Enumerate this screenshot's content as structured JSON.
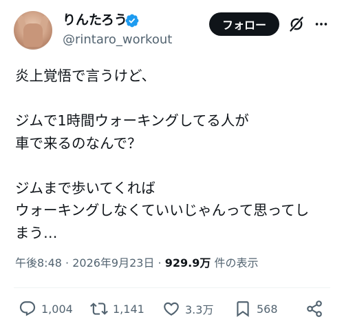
{
  "user": {
    "display_name": "りんたろう",
    "handle": "@rintaro_workout",
    "verified_icon": "verified-badge-icon",
    "verified_color": "#1d9bf0"
  },
  "header": {
    "follow_label": "フォロー",
    "grok_icon": "grok-icon",
    "more_icon": "more-icon"
  },
  "tweet": {
    "text": "炎上覚悟で言うけど、\n\nジムで1時間ウォーキングしてる人が\n車で来るのなんで？\n\nジムまで歩いてくれば\nウォーキングしなくていいじゃんって思ってし\nまう…"
  },
  "meta": {
    "time": "午後8:48",
    "separator": " · ",
    "date": "2026年9月23日",
    "views_count": "929.9万",
    "views_label": " 件の表示"
  },
  "actions": {
    "reply_count": "1,004",
    "retweet_count": "1,141",
    "like_count": "3.3万",
    "bookmark_count": "568"
  },
  "colors": {
    "text": "#0f1419",
    "secondary": "#536471",
    "accent": "#1d9bf0",
    "divider": "#eff3f4"
  }
}
